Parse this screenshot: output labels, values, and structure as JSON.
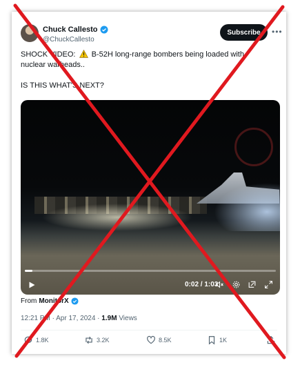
{
  "author": {
    "name": "Chuck Callesto",
    "handle": "@ChuckCallesto"
  },
  "subscribe_label": "Subscribe",
  "tweet": {
    "line1_before": "SHOCK VIDEO:",
    "line1_after": "B-52H long-range bombers being loaded with",
    "line2": "nuclear warheads..",
    "line3": "IS THIS WHAT'S NEXT?"
  },
  "video": {
    "time": "0:02 / 1:03",
    "progress": 0.03
  },
  "source": {
    "prefix": "From",
    "account": "MonitorX"
  },
  "meta": {
    "datetime": "12:21 PM · Apr 17, 2024 ·",
    "views_count": "1.9M",
    "views_label": "Views"
  },
  "actions": {
    "replies": "1.8K",
    "reposts": "3.2K",
    "likes": "8.5K",
    "bookmarks": "1K"
  },
  "colors": {
    "overlay_cross": "#e0191f",
    "verified": "#1d9bf0",
    "warning": "#f4c400"
  }
}
